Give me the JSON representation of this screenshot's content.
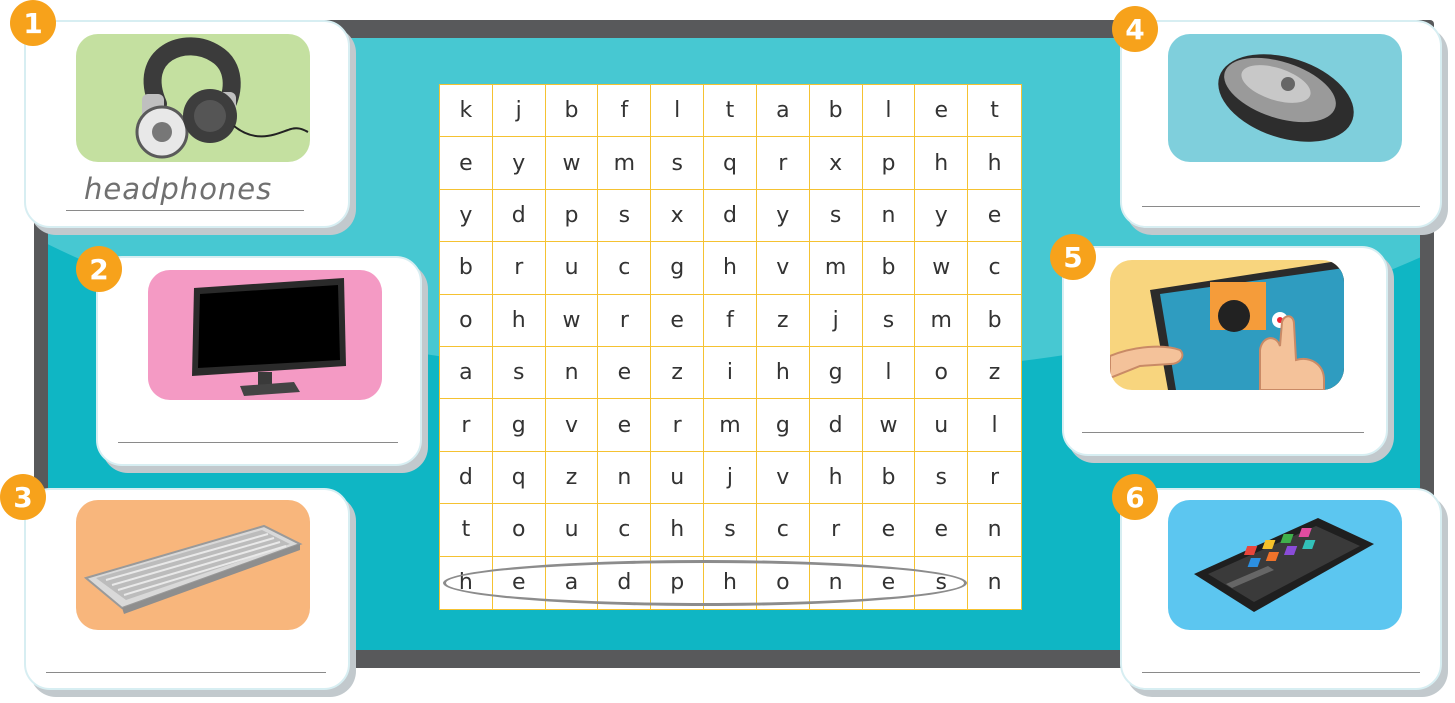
{
  "colors": {
    "badge": "#f7a21b",
    "board": "#0fb6c4",
    "frame": "#58595b",
    "grid_line": "#f5c231"
  },
  "items": [
    {
      "number": "1",
      "picture": "headphones-icon",
      "answer": "headphones"
    },
    {
      "number": "2",
      "picture": "monitor-icon",
      "answer": ""
    },
    {
      "number": "3",
      "picture": "keyboard-icon",
      "answer": ""
    },
    {
      "number": "4",
      "picture": "mouse-icon",
      "answer": ""
    },
    {
      "number": "5",
      "picture": "touchscreen-icon",
      "answer": ""
    },
    {
      "number": "6",
      "picture": "tablet-icon",
      "answer": ""
    }
  ],
  "word_search": {
    "rows": [
      [
        "k",
        "j",
        "b",
        "f",
        "l",
        "t",
        "a",
        "b",
        "l",
        "e",
        "t"
      ],
      [
        "e",
        "y",
        "w",
        "m",
        "s",
        "q",
        "r",
        "x",
        "p",
        "h",
        "h"
      ],
      [
        "y",
        "d",
        "p",
        "s",
        "x",
        "d",
        "y",
        "s",
        "n",
        "y",
        "e"
      ],
      [
        "b",
        "r",
        "u",
        "c",
        "g",
        "h",
        "v",
        "m",
        "b",
        "w",
        "c"
      ],
      [
        "o",
        "h",
        "w",
        "r",
        "e",
        "f",
        "z",
        "j",
        "s",
        "m",
        "b"
      ],
      [
        "a",
        "s",
        "n",
        "e",
        "z",
        "i",
        "h",
        "g",
        "l",
        "o",
        "z"
      ],
      [
        "r",
        "g",
        "v",
        "e",
        "r",
        "m",
        "g",
        "d",
        "w",
        "u",
        "l"
      ],
      [
        "d",
        "q",
        "z",
        "n",
        "u",
        "j",
        "v",
        "h",
        "b",
        "s",
        "r"
      ],
      [
        "t",
        "o",
        "u",
        "c",
        "h",
        "s",
        "c",
        "r",
        "e",
        "e",
        "n"
      ],
      [
        "h",
        "e",
        "a",
        "d",
        "p",
        "h",
        "o",
        "n",
        "e",
        "s",
        "n"
      ]
    ],
    "circled_word": "headphones"
  }
}
